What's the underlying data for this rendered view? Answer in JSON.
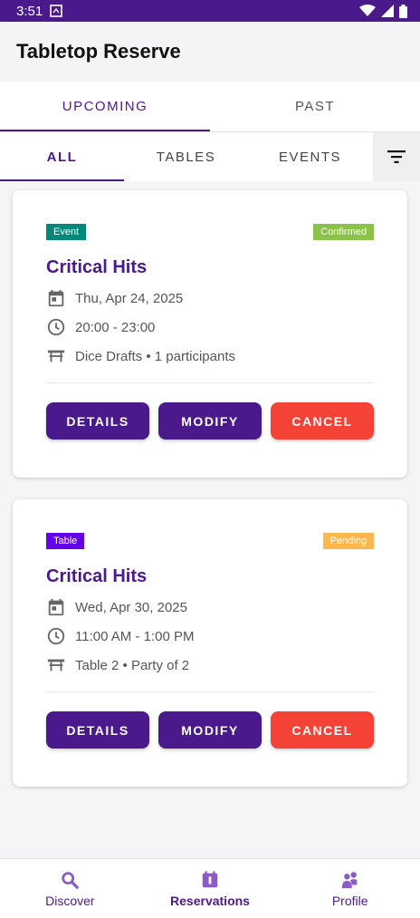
{
  "status_bar": {
    "time": "3:51"
  },
  "app": {
    "title": "Tabletop Reserve"
  },
  "primary_tabs": [
    {
      "label": "UPCOMING",
      "active": true
    },
    {
      "label": "PAST",
      "active": false
    }
  ],
  "secondary_tabs": [
    {
      "label": "ALL",
      "active": true
    },
    {
      "label": "TABLES",
      "active": false
    },
    {
      "label": "EVENTS",
      "active": false
    }
  ],
  "reservations": [
    {
      "type_badge": "Event",
      "type_color": "#00897b",
      "status_badge": "Confirmed",
      "status_color": "#8bc34a",
      "title": "Critical Hits",
      "date": "Thu, Apr 24, 2025",
      "time": "20:00 - 23:00",
      "detail": "Dice Drafts • 1 participants",
      "actions": {
        "details": "DETAILS",
        "modify": "MODIFY",
        "cancel": "CANCEL"
      }
    },
    {
      "type_badge": "Table",
      "type_color": "#6200ea",
      "status_badge": "Pending",
      "status_color": "#ffb74d",
      "title": "Critical Hits",
      "date": "Wed, Apr 30, 2025",
      "time": "11:00 AM - 1:00 PM",
      "detail": "Table 2 • Party of 2",
      "actions": {
        "details": "DETAILS",
        "modify": "MODIFY",
        "cancel": "CANCEL"
      }
    }
  ],
  "bottom_nav": [
    {
      "label": "Discover",
      "icon": "search-icon",
      "active": false
    },
    {
      "label": "Reservations",
      "icon": "calendar-icon",
      "active": true
    },
    {
      "label": "Profile",
      "icon": "people-icon",
      "active": false
    }
  ],
  "colors": {
    "primary": "#4a1a8c",
    "danger": "#f44336",
    "status_bar": "#4a1a8c"
  }
}
